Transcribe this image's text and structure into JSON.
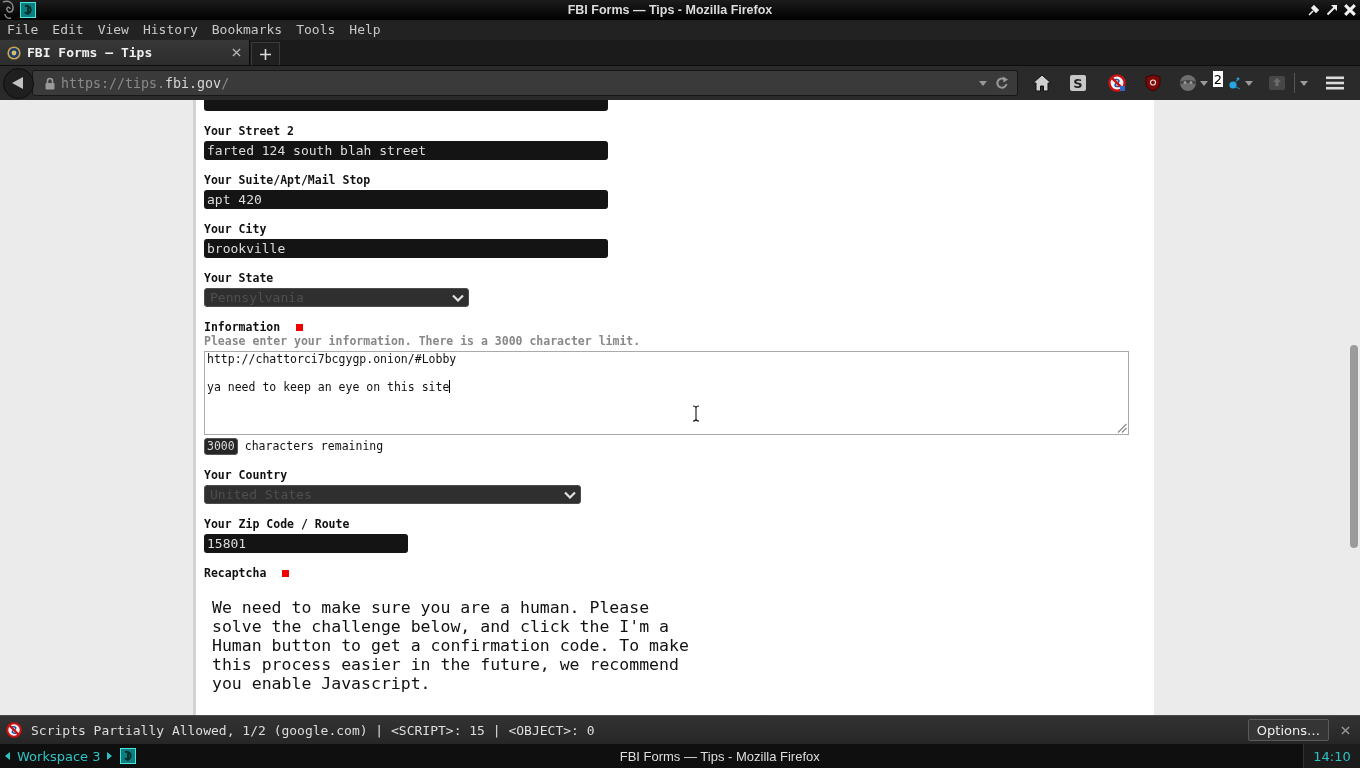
{
  "window": {
    "title": "FBI Forms — Tips - Mozilla Firefox"
  },
  "menu_bar": [
    {
      "label": "File"
    },
    {
      "label": "Edit"
    },
    {
      "label": "View"
    },
    {
      "label": "History"
    },
    {
      "label": "Bookmarks"
    },
    {
      "label": "Tools"
    },
    {
      "label": "Help"
    }
  ],
  "tabs": [
    {
      "title": "FBI Forms — Tips",
      "selected": true
    }
  ],
  "address_bar": {
    "url": "https://tips.**fbi.gov**/"
  },
  "toolbar": [
    {
      "kind": "home",
      "menu_arrow": false,
      "disabled": false
    },
    {
      "kind": "letter",
      "text": "S",
      "menu_arrow": false,
      "disabled": false
    },
    {
      "kind": "noscript",
      "menu_arrow": false,
      "disabled": false
    },
    {
      "kind": "shield",
      "menu_arrow": false,
      "disabled": false
    },
    {
      "kind": "mask",
      "menu_arrow": true,
      "disabled": false
    },
    {
      "kind": "counter",
      "text": "2",
      "menu_arrow": false,
      "disabled": false
    },
    {
      "kind": "droplet",
      "menu_arrow": true,
      "disabled": false
    },
    {
      "kind": "share",
      "menu_arrow": true,
      "disabled": true
    },
    {
      "kind": "hamburger",
      "menu_arrow": false,
      "disabled": false
    }
  ],
  "form": {
    "fields": [
      {
        "kind": "text"
      },
      {
        "kind": "text",
        "label": "Your Street 2",
        "required": false,
        "value": "farted 124 south blah street"
      },
      {
        "kind": "text",
        "label": "Your Suite/Apt/Mail Stop",
        "required": false,
        "value": "apt 420"
      },
      {
        "kind": "text",
        "label": "Your City",
        "required": false,
        "value": "brookville"
      },
      {
        "kind": "select",
        "label": "Your State",
        "required": false,
        "value": "Pennsylvania"
      },
      {
        "kind": "textarea",
        "label": "Information",
        "required": true,
        "hint": "Please enter your information. There is a 3000 character limit.",
        "value": "http://chattorci7bcgygp.onion/#Lobby\n\nya need to keep an eye on this site",
        "counter": "3000",
        "counter_label": "characters remaining"
      },
      {
        "kind": "select",
        "label": "Your Country",
        "required": false,
        "value": "United States"
      },
      {
        "kind": "text",
        "label": "Your Zip Code / Route",
        "required": false,
        "value": "15801"
      },
      {
        "kind": "captcha",
        "label": "Recaptcha",
        "required": true,
        "text": "We need to make sure you are a human. Please solve the challenge below, and click the I'm a Human button to get a confirmation code. To make this process easier in the future, we recommend you enable Javascript."
      }
    ]
  },
  "notification_bar": {
    "message": "Scripts Partially Allowed, 1/2 (google.com) | <SCRIPT>: 15 | <OBJECT>: 0",
    "button": "Options…"
  },
  "taskbar": {
    "workspace": "Workspace 3",
    "title": "FBI Forms — Tips - Mozilla Firefox",
    "clock": "14:10"
  }
}
